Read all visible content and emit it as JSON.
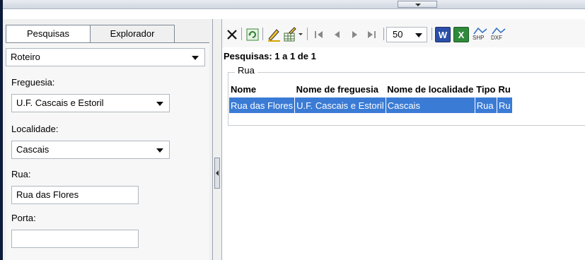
{
  "left_panel": {
    "tabs": [
      {
        "label": "Pesquisas"
      },
      {
        "label": "Explorador"
      }
    ],
    "search_type": "Roteiro",
    "freguesia": {
      "label": "Freguesia:",
      "value": "U.F. Cascais e Estoril"
    },
    "localidade": {
      "label": "Localidade:",
      "value": "Cascais"
    },
    "rua": {
      "label": "Rua:",
      "value": "Rua das Flores"
    },
    "porta": {
      "label": "Porta:",
      "value": ""
    }
  },
  "toolbar": {
    "page_size": "50",
    "icons": [
      "close-icon",
      "refresh-icon",
      "edit-icon",
      "table-edit-icon",
      "first-page-icon",
      "prev-page-icon",
      "next-page-icon",
      "last-page-icon",
      "word-export-icon",
      "excel-export-icon",
      "shp-export-icon",
      "dxf-export-icon"
    ],
    "shp_label": "SHP",
    "dxf_label": "DXF",
    "word_label": "W",
    "excel_label": "X"
  },
  "results": {
    "count_text": "Pesquisas: 1 a 1 de 1",
    "group_label": "Rua",
    "columns": [
      "Nome",
      "Nome de freguesia",
      "Nome de localidade",
      "Tipo",
      "Ru"
    ],
    "rows": [
      [
        "Rua das Flores",
        "U.F. Cascais e Estoril",
        "Cascais",
        "Rua",
        "Ru"
      ]
    ]
  },
  "colors": {
    "selection": "#3a7bd5",
    "frame": "#0d1b3a"
  }
}
